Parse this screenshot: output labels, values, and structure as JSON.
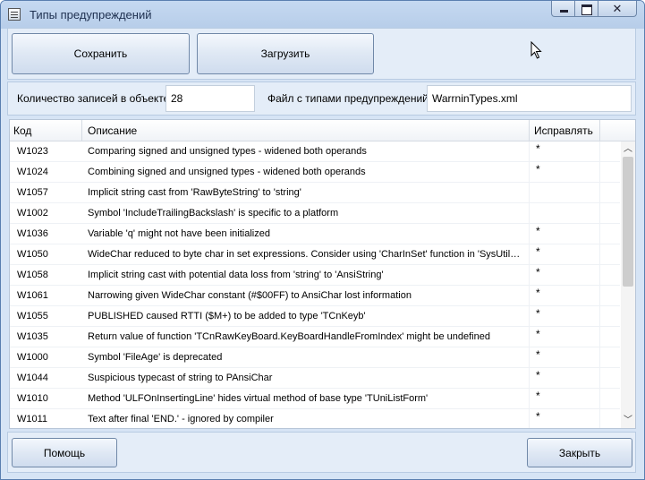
{
  "window": {
    "title": "Типы предупреждений",
    "controls": {
      "minimize": "minimize-icon",
      "maximize": "maximize-icon",
      "close": "close-icon"
    }
  },
  "toolbar": {
    "save_label": "Сохранить",
    "load_label": "Загрузить"
  },
  "info": {
    "count_label": "Количество записей в объекте",
    "count_value": "28",
    "file_label": "Файл с типами предупреждений",
    "file_value": "WarrninTypes.xml"
  },
  "table": {
    "columns": [
      "Код",
      "Описание",
      "Исправлять"
    ],
    "rows": [
      {
        "code": "W1023",
        "desc": "Comparing signed and unsigned types - widened both operands",
        "fix": "*"
      },
      {
        "code": "W1024",
        "desc": "Combining signed and unsigned types - widened both operands",
        "fix": "*"
      },
      {
        "code": "W1057",
        "desc": "Implicit string cast from 'RawByteString' to 'string'",
        "fix": ""
      },
      {
        "code": "W1002",
        "desc": "Symbol 'IncludeTrailingBackslash' is specific to a platform",
        "fix": ""
      },
      {
        "code": "W1036",
        "desc": "Variable 'q' might not have been initialized",
        "fix": "*"
      },
      {
        "code": "W1050",
        "desc": "WideChar reduced to byte char in set expressions.  Consider using 'CharInSet' function in 'SysUtils' unit.",
        "fix": "*"
      },
      {
        "code": "W1058",
        "desc": "Implicit string cast with potential data loss from 'string' to 'AnsiString'",
        "fix": "*"
      },
      {
        "code": "W1061",
        "desc": "Narrowing given WideChar constant (#$00FF) to AnsiChar lost information",
        "fix": "*"
      },
      {
        "code": "W1055",
        "desc": "PUBLISHED caused RTTI ($M+) to be added to type 'TCnKeyb'",
        "fix": "*"
      },
      {
        "code": "W1035",
        "desc": "Return value of function 'TCnRawKeyBoard.KeyBoardHandleFromIndex' might be undefined",
        "fix": "*"
      },
      {
        "code": "W1000",
        "desc": "Symbol 'FileAge' is deprecated",
        "fix": "*"
      },
      {
        "code": "W1044",
        "desc": "Suspicious typecast of string to PAnsiChar",
        "fix": "*"
      },
      {
        "code": "W1010",
        "desc": "Method 'ULFOnInsertingLine' hides virtual method of base type 'TUniListForm'",
        "fix": "*"
      },
      {
        "code": "W1011",
        "desc": "Text after final 'END.' - ignored by compiler",
        "fix": "*"
      }
    ]
  },
  "footer": {
    "help_label": "Помощь",
    "close_label": "Закрыть"
  }
}
